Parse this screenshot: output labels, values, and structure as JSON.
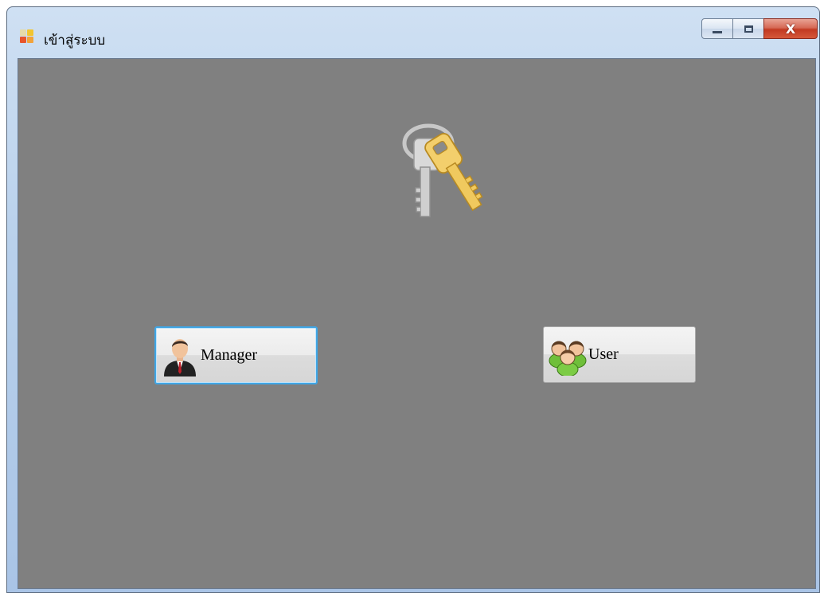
{
  "window": {
    "title": "เข้าสู่ระบบ",
    "caption_buttons": {
      "minimize": "minimize",
      "maximize": "maximize",
      "close": "X"
    }
  },
  "client": {
    "background": "#808080"
  },
  "buttons": {
    "manager": {
      "label": "Manager",
      "icon": "manager-icon"
    },
    "user": {
      "label": "User",
      "icon": "users-icon"
    }
  }
}
